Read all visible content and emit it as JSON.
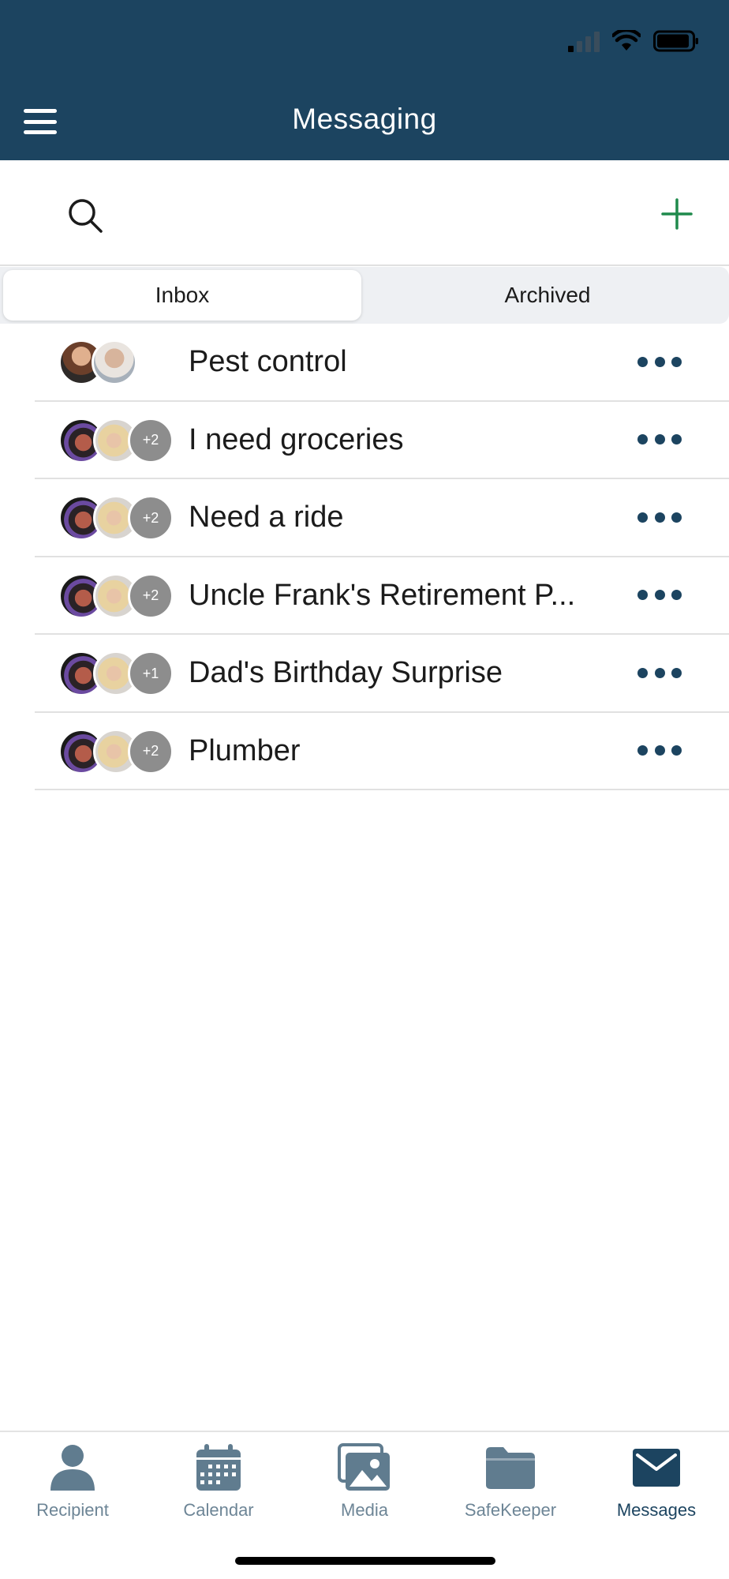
{
  "header": {
    "title": "Messaging",
    "background": "#1c4460"
  },
  "toolbar": {
    "search_icon": "search-icon",
    "add_icon": "plus-icon",
    "add_color": "#1f8a4c"
  },
  "tabs": [
    {
      "label": "Inbox",
      "active": true
    },
    {
      "label": "Archived",
      "active": false
    }
  ],
  "conversations": [
    {
      "title": "Pest control",
      "extra": ""
    },
    {
      "title": "I need groceries",
      "extra": "+2"
    },
    {
      "title": "Need a ride",
      "extra": "+2"
    },
    {
      "title": "Uncle Frank's Retirement P...",
      "extra": "+2"
    },
    {
      "title": "Dad's Birthday Surprise",
      "extra": "+1"
    },
    {
      "title": "Plumber",
      "extra": "+2"
    }
  ],
  "bottom_nav": [
    {
      "label": "Recipient",
      "icon": "person-icon",
      "active": false
    },
    {
      "label": "Calendar",
      "icon": "calendar-icon",
      "active": false
    },
    {
      "label": "Media",
      "icon": "image-icon",
      "active": false
    },
    {
      "label": "SafeKeeper",
      "icon": "folder-icon",
      "active": false
    },
    {
      "label": "Messages",
      "icon": "envelope-icon",
      "active": true
    }
  ],
  "colors": {
    "accent": "#1c4460",
    "nav_inactive": "#6d8596"
  }
}
